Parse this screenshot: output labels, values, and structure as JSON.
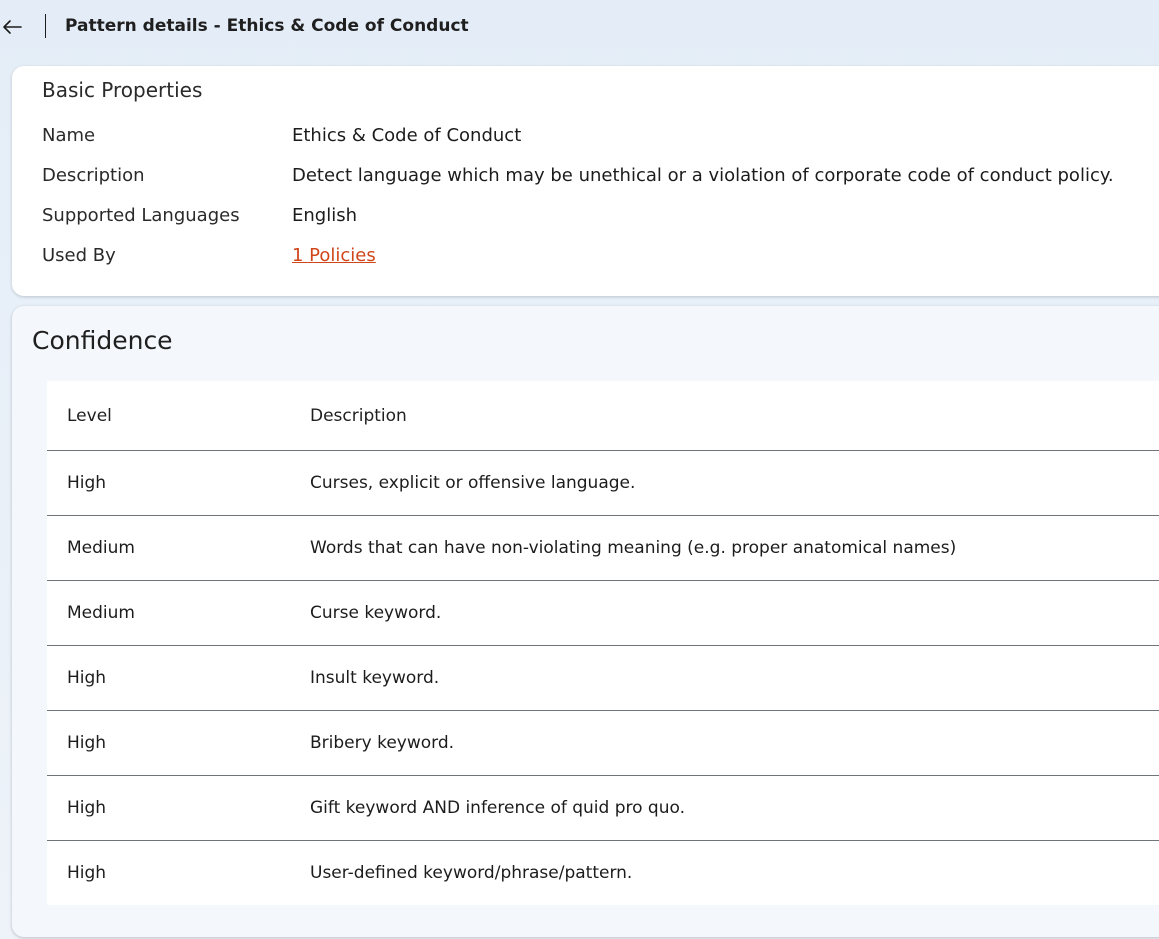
{
  "header": {
    "back_icon": "arrow-left-icon",
    "title": "Pattern details - Ethics & Code of Conduct"
  },
  "basic": {
    "heading": "Basic Properties",
    "properties": [
      {
        "label": "Name",
        "value": "Ethics & Code of Conduct"
      },
      {
        "label": "Description",
        "value": "Detect language which may be unethical or a violation of corporate code of conduct policy."
      },
      {
        "label": "Supported Languages",
        "value": "English"
      },
      {
        "label": "Used By",
        "value": "1 Policies"
      }
    ],
    "link_color": "#d0461a"
  },
  "confidence": {
    "heading": "Confidence",
    "columns": [
      "Level",
      "Description"
    ],
    "rows": [
      {
        "level": "High",
        "description": "Curses, explicit or offensive language."
      },
      {
        "level": "Medium",
        "description": "Words that can have non-violating meaning (e.g. proper anatomical names)"
      },
      {
        "level": "Medium",
        "description": "Curse keyword."
      },
      {
        "level": "High",
        "description": "Insult keyword."
      },
      {
        "level": "High",
        "description": "Bribery keyword."
      },
      {
        "level": "High",
        "description": "Gift keyword AND inference of quid pro quo."
      },
      {
        "level": "High",
        "description": "User-defined keyword/phrase/pattern."
      }
    ]
  }
}
